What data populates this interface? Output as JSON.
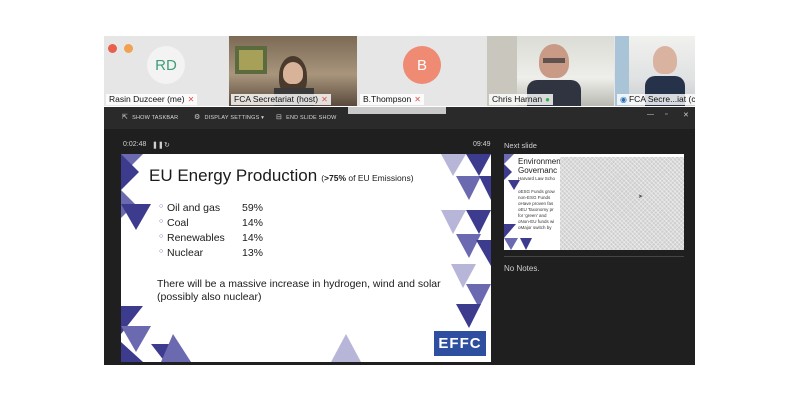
{
  "participants": [
    {
      "initials": "RD",
      "name": "Rasin Duzceer (me)",
      "mic": "muted",
      "avatar_color": "#f0f0f0",
      "initials_color": "#3f9e78"
    },
    {
      "name": "FCA Secretariat (host)",
      "mic": "muted"
    },
    {
      "initials": "B",
      "name": "B.Thompson",
      "mic": "muted",
      "avatar_color": "#ef8a73",
      "initials_color": "#ffffff"
    },
    {
      "name": "Chris Harnan",
      "mic": "on"
    },
    {
      "name": "FCA Secre...iat (c",
      "mic": "none"
    }
  ],
  "window_dots": [
    "#e8604c",
    "#f1a250"
  ],
  "toolbar": {
    "show_taskbar": "SHOW TASKBAR",
    "display_settings": "DISPLAY SETTINGS ▾",
    "end_slide_show": "END SLIDE SHOW"
  },
  "presenter": {
    "elapsed": "0:02:48",
    "clock": "09:49",
    "next_slide_label": "Next slide",
    "notes": "No Notes."
  },
  "slide": {
    "title": "EU Energy Production",
    "subtitle_prefix": "(",
    "subtitle_bold": ">75%",
    "subtitle_rest": " of EU Emissions)",
    "bullets": [
      {
        "label": "Oil and gas",
        "value": "59%"
      },
      {
        "label": "Coal",
        "value": "14%"
      },
      {
        "label": "Renewables",
        "value": "14%"
      },
      {
        "label": "Nuclear",
        "value": "13%"
      }
    ],
    "note": "There will be a massive increase in hydrogen, wind and solar (possibly also nuclear)",
    "logo": "EFFC",
    "accent_color": "#3d3b8e"
  },
  "next_slide": {
    "title_line1": "Environmen",
    "title_line2": "Governanc",
    "subtitle": "Harvard Law Scho",
    "lines": [
      "oESG Funds grow",
      "non-ESG Funds",
      "oHave proven fas",
      "oEU Taxonomy pr",
      "for 'green' and",
      "oNon-EU funds wi",
      "oMajor switch by"
    ]
  }
}
